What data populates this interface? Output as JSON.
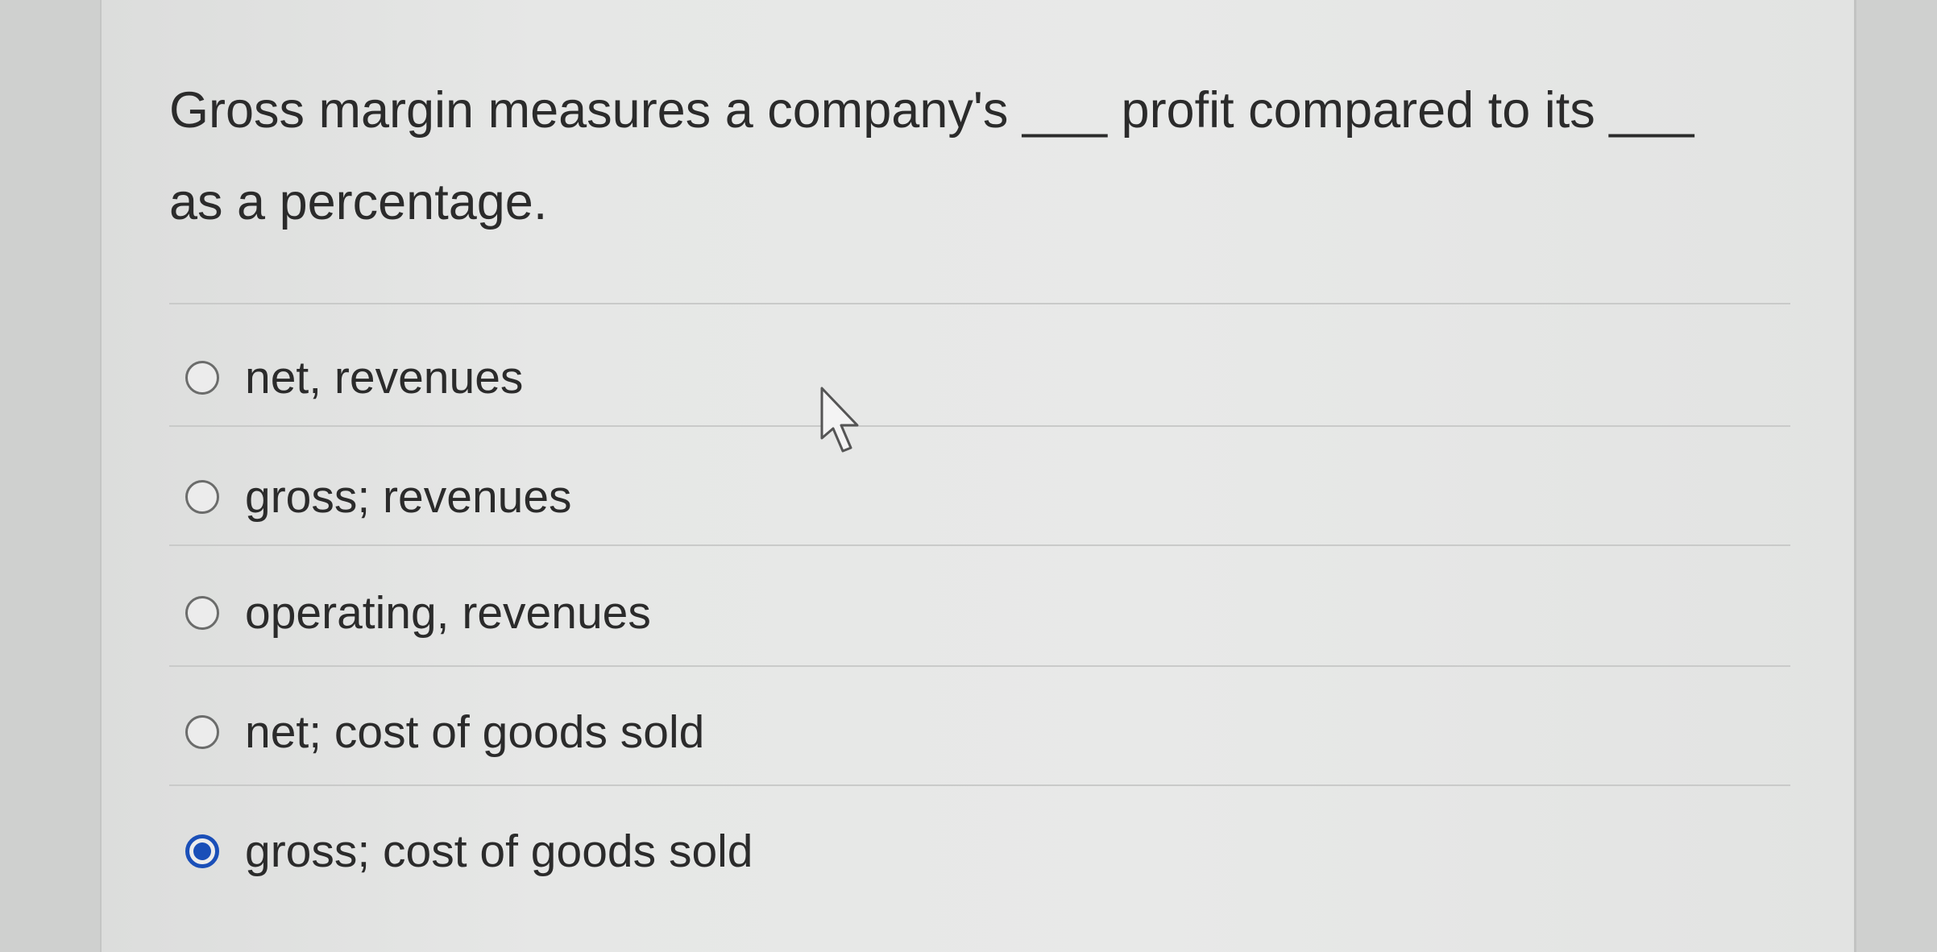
{
  "question": {
    "line1": "Gross margin measures a company's ___ profit compared to its ___",
    "line2": "as a percentage."
  },
  "options": [
    {
      "label": "net, revenues",
      "selected": false
    },
    {
      "label": "gross; revenues",
      "selected": false
    },
    {
      "label": "operating, revenues",
      "selected": false
    },
    {
      "label": "net; cost of goods sold",
      "selected": false
    },
    {
      "label": "gross; cost of goods sold",
      "selected": true
    }
  ],
  "colors": {
    "selected_radio": "#1a4fb8",
    "text": "#2b2b2b",
    "divider": "#c9cac9"
  },
  "icons": {
    "cursor": "mouse-pointer-icon"
  }
}
